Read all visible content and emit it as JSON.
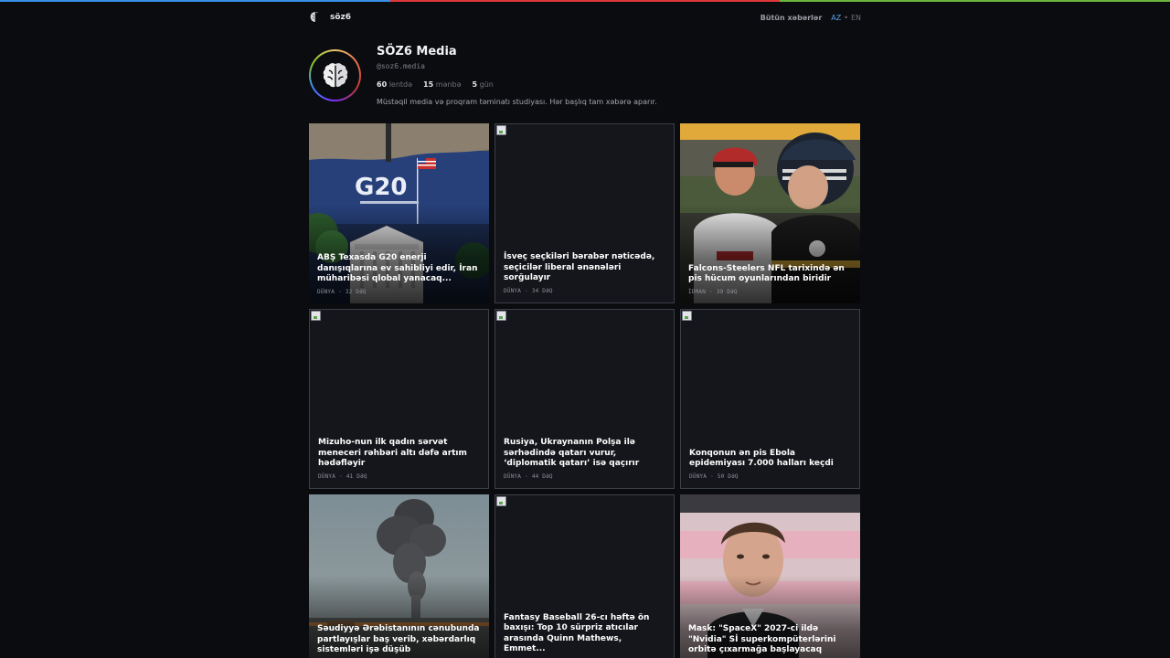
{
  "accent_stripe_colors": [
    "#3a8ee6",
    "#e0383a",
    "#6bb53f"
  ],
  "nav": {
    "brand_name": "söz6",
    "brand_icon": "brain-icon",
    "all_news_label": "Bütün xəbərlər",
    "lang_active": "AZ",
    "lang_separator": "•",
    "lang_inactive": "EN"
  },
  "profile": {
    "avatar_icon": "brain-icon",
    "title": "SÖZ6 Media",
    "handle": "@soz6.media",
    "stats": [
      {
        "value": "60",
        "label": "lentdə"
      },
      {
        "value": "15",
        "label": "mənbə"
      },
      {
        "value": "5",
        "label": "gün"
      }
    ],
    "description": "Müstəqil media və proqram təminatı studiyası. Hər başlıq tam xəbərə aparır."
  },
  "cards": [
    {
      "title": "ABŞ Texasda G20 enerji danışıqlarına ev sahibliyi edir, İran müharibəsi qlobal yanacaq...",
      "category": "DÜNYA",
      "sep": "·",
      "time": "32 DƏQ",
      "image": "g20"
    },
    {
      "title": "İsveç seçkiləri bərabər nəticədə, seçicilər liberal ənənələri sorğulayır",
      "category": "DÜNYA",
      "sep": "·",
      "time": "34 DƏQ",
      "image": "none"
    },
    {
      "title": "Falcons-Steelers NFL tarixində ən pis hücum oyunlarından biridir",
      "category": "İDMAN",
      "sep": "·",
      "time": "39 DƏQ",
      "image": "football"
    },
    {
      "title": "Mizuho-nun ilk qadın sərvət meneceri rəhbəri altı dəfə artım hədəfləyir",
      "category": "DÜNYA",
      "sep": "·",
      "time": "41 DƏQ",
      "image": "none"
    },
    {
      "title": "Rusiya, Ukraynanın Polşa ilə sərhədində qatarı vurur, ‘diplomatik qatarı’ isə qaçırır",
      "category": "DÜNYA",
      "sep": "·",
      "time": "44 DƏQ",
      "image": "none"
    },
    {
      "title": "Konqonun ən pis Ebola epidemiyası 7.000 halları keçdi",
      "category": "DÜNYA",
      "sep": "·",
      "time": "50 DƏQ",
      "image": "none"
    },
    {
      "title": "Səudiyyə Ərəbistanının cənubunda partlayışlar baş verib, xəbərdarlıq sistemləri işə düşüb",
      "category": "",
      "sep": "",
      "time": "",
      "image": "smoke"
    },
    {
      "title": "Fantasy Baseball 26-cı həftə ön baxışı: Top 10 sürpriz atıcılar arasında Quinn Mathews, Emmet...",
      "category": "",
      "sep": "",
      "time": "",
      "image": "none"
    },
    {
      "title": "Mask: \"SpaceX\" 2027-ci ildə \"Nvidia\" Sİ superkompüterlərini orbitə çıxarmağa başlayacaq",
      "category": "",
      "sep": "",
      "time": "",
      "image": "portrait"
    }
  ]
}
